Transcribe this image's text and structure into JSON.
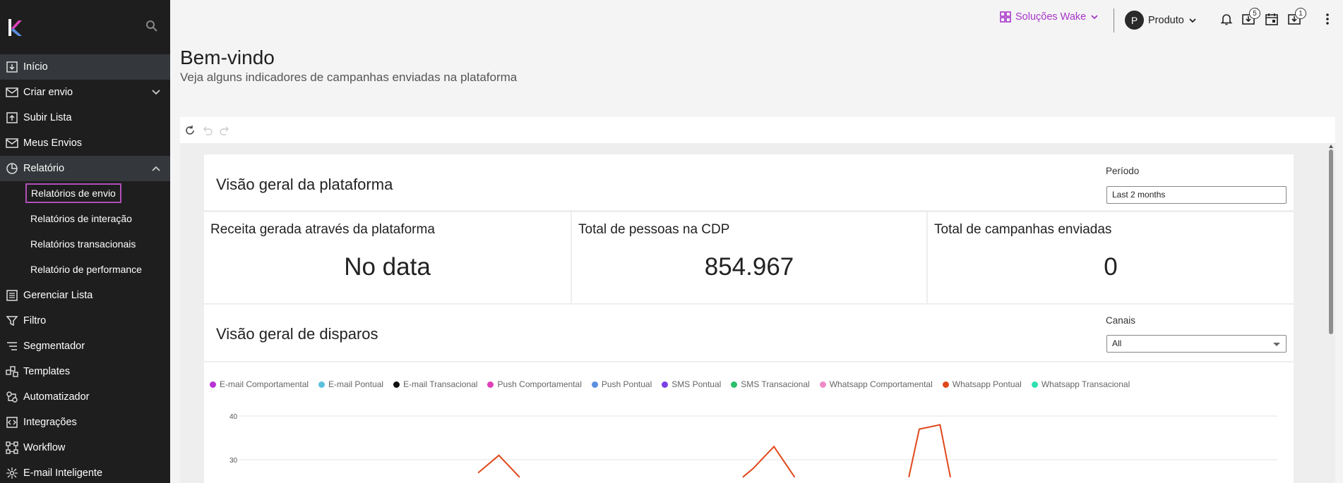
{
  "sidebar": {
    "items": [
      {
        "label": "Início",
        "icon": "download-box-icon"
      },
      {
        "label": "Criar envio",
        "icon": "envelope-icon"
      },
      {
        "label": "Subir Lista",
        "icon": "upload-box-icon"
      },
      {
        "label": "Meus Envios",
        "icon": "mail-check-icon"
      },
      {
        "label": "Relatório",
        "icon": "pie-chart-icon"
      },
      {
        "label": "Gerenciar Lista",
        "icon": "list-icon"
      },
      {
        "label": "Filtro",
        "icon": "filter-icon"
      },
      {
        "label": "Segmentador",
        "icon": "segment-icon"
      },
      {
        "label": "Templates",
        "icon": "templates-icon"
      },
      {
        "label": "Automatizador",
        "icon": "automation-icon"
      },
      {
        "label": "Integrações",
        "icon": "integration-icon"
      },
      {
        "label": "Workflow",
        "icon": "workflow-icon"
      },
      {
        "label": "E-mail Inteligente",
        "icon": "smart-email-icon"
      }
    ],
    "sub_items": [
      {
        "label": "Relatórios de envio"
      },
      {
        "label": "Relatórios de interação"
      },
      {
        "label": "Relatórios transacionais"
      },
      {
        "label": "Relatório de performance"
      }
    ]
  },
  "topbar": {
    "solucoes_label": "Soluções Wake",
    "avatar_letter": "P",
    "profile_label": "Produto",
    "badge_1": "5",
    "badge_2": "1",
    "accent_color": "#a935c9"
  },
  "page": {
    "title": "Bem-vindo",
    "subtitle": "Veja alguns indicadores de campanhas enviadas na plataforma"
  },
  "overview": {
    "title": "Visão geral da plataforma",
    "period_label": "Período",
    "period_value": "Last 2 months"
  },
  "kpis": [
    {
      "title": "Receita gerada através da plataforma",
      "value": "No data"
    },
    {
      "title": "Total de pessoas na CDP",
      "value": "854.967"
    },
    {
      "title": "Total de campanhas enviadas",
      "value": "0"
    }
  ],
  "disparos": {
    "title": "Visão geral de disparos",
    "canais_label": "Canais",
    "canais_value": "All"
  },
  "chart_data": {
    "type": "line",
    "legend": [
      {
        "name": "E-mail Comportamental",
        "color": "#b832d6"
      },
      {
        "name": "E-mail Pontual",
        "color": "#5bc0de"
      },
      {
        "name": "E-mail Transacional",
        "color": "#111111"
      },
      {
        "name": "Push Comportamental",
        "color": "#e040b8"
      },
      {
        "name": "Push Pontual",
        "color": "#5b8fe0"
      },
      {
        "name": "SMS Pontual",
        "color": "#7b3fe4"
      },
      {
        "name": "SMS Transacional",
        "color": "#2bbf6a"
      },
      {
        "name": "Whatsapp Comportamental",
        "color": "#f08ac8"
      },
      {
        "name": "Whatsapp Pontual",
        "color": "#e0481b"
      },
      {
        "name": "Whatsapp Transacional",
        "color": "#2fe0b0"
      }
    ],
    "y_ticks": [
      "40",
      "30"
    ],
    "ylim": [
      0,
      40
    ],
    "visible_series": {
      "name": "Whatsapp Pontual",
      "points": [
        {
          "x": 0.23,
          "y": 27
        },
        {
          "x": 0.25,
          "y": 31
        },
        {
          "x": 0.27,
          "y": 26
        },
        {
          "x": 0.485,
          "y": 26
        },
        {
          "x": 0.495,
          "y": 28
        },
        {
          "x": 0.515,
          "y": 33
        },
        {
          "x": 0.535,
          "y": 26
        },
        {
          "x": 0.645,
          "y": 26
        },
        {
          "x": 0.655,
          "y": 37
        },
        {
          "x": 0.675,
          "y": 38
        },
        {
          "x": 0.685,
          "y": 26
        }
      ]
    }
  }
}
